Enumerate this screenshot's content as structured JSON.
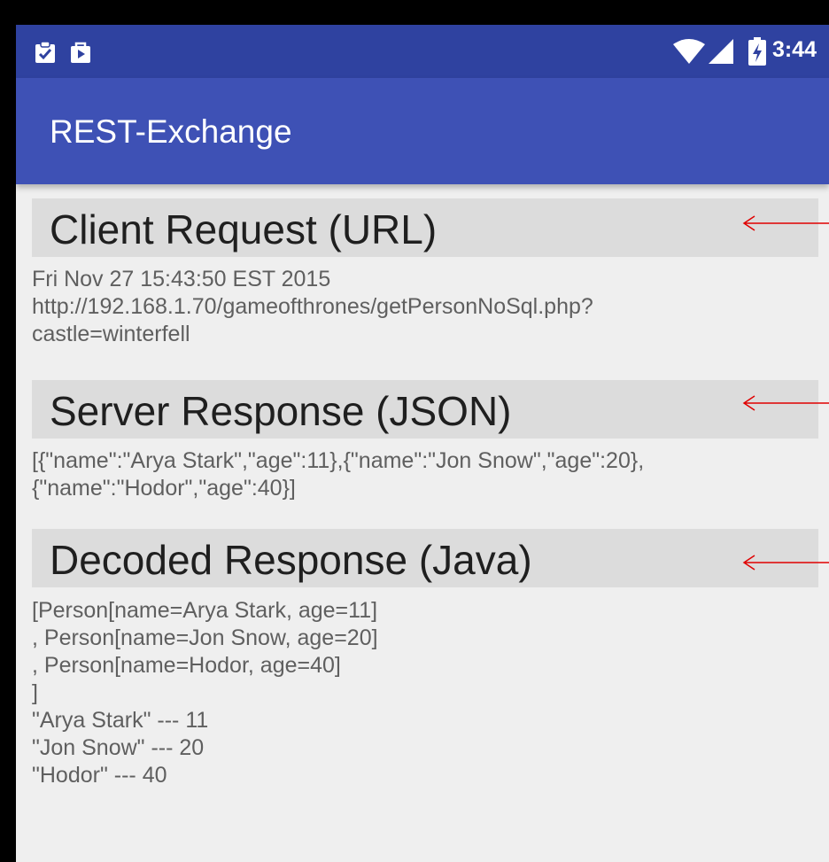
{
  "status_bar": {
    "time": "3:44",
    "icons": [
      "clipboard-check-icon",
      "play-store-icon",
      "wifi-icon",
      "signal-icon",
      "battery-charging-icon"
    ],
    "color": "#2f42a0"
  },
  "app_bar": {
    "title": "REST-Exchange",
    "color": "#3e51b5"
  },
  "sections": [
    {
      "title": "Client Request (URL)",
      "lines": [
        "Fri Nov 27 15:43:50 EST 2015",
        "http://192.168.1.70/gameofthrones/getPersonNoSql.php?",
        "castle=winterfell"
      ]
    },
    {
      "title": "Server Response (JSON)",
      "lines": [
        "[{\"name\":\"Arya Stark\",\"age\":11},{\"name\":\"Jon Snow\",\"age\":20},",
        "{\"name\":\"Hodor\",\"age\":40}]"
      ]
    },
    {
      "title": "Decoded Response (Java)",
      "lines": [
        "[Person[name=Arya Stark, age=11]",
        ", Person[name=Jon Snow, age=20]",
        ", Person[name=Hodor, age=40]",
        "]",
        "\"Arya Stark\" --- 11",
        "\"Jon Snow\" --- 20",
        "\"Hodor\" --- 40"
      ]
    }
  ],
  "annotation_color": "#e00000"
}
